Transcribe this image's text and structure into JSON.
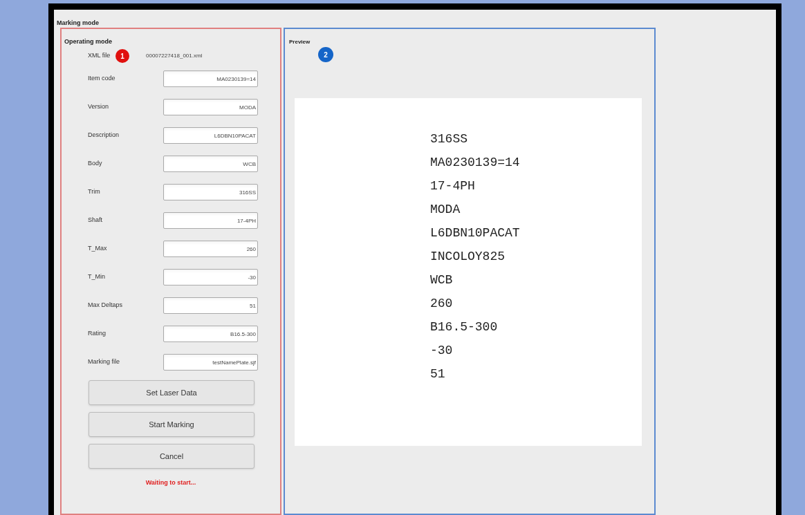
{
  "window": {
    "title": "Marking mode"
  },
  "operating_mode": {
    "title": "Operating mode",
    "badge": "1",
    "xml_file": {
      "label": "XML file",
      "value": "00007227418_001.xml"
    },
    "fields": [
      {
        "label": "Item code",
        "value": "MA0230139=14"
      },
      {
        "label": "Version",
        "value": "MODA"
      },
      {
        "label": "Description",
        "value": "L6DBN10PACAT"
      },
      {
        "label": "Body",
        "value": "WCB"
      },
      {
        "label": "Trim",
        "value": "316SS"
      },
      {
        "label": "Shaft",
        "value": "17-4PH"
      },
      {
        "label": "T_Max",
        "value": "260"
      },
      {
        "label": "T_Min",
        "value": "-30"
      },
      {
        "label": "Max Deltaps",
        "value": "51"
      },
      {
        "label": "Rating",
        "value": "B16.5-300"
      },
      {
        "label": "Marking file",
        "value": "testNamePlate.sjf"
      }
    ],
    "buttons": [
      "Set Laser Data",
      "Start Marking",
      "Cancel"
    ],
    "status": "Waiting to start..."
  },
  "preview": {
    "title": "Preview",
    "badge": "2",
    "lines": [
      "316SS",
      "MA0230139=14",
      "17-4PH",
      "MODA",
      "L6DBN10PACAT",
      "INCOLOY825",
      "WCB",
      "260",
      "B16.5-300",
      "-30",
      "51"
    ]
  }
}
